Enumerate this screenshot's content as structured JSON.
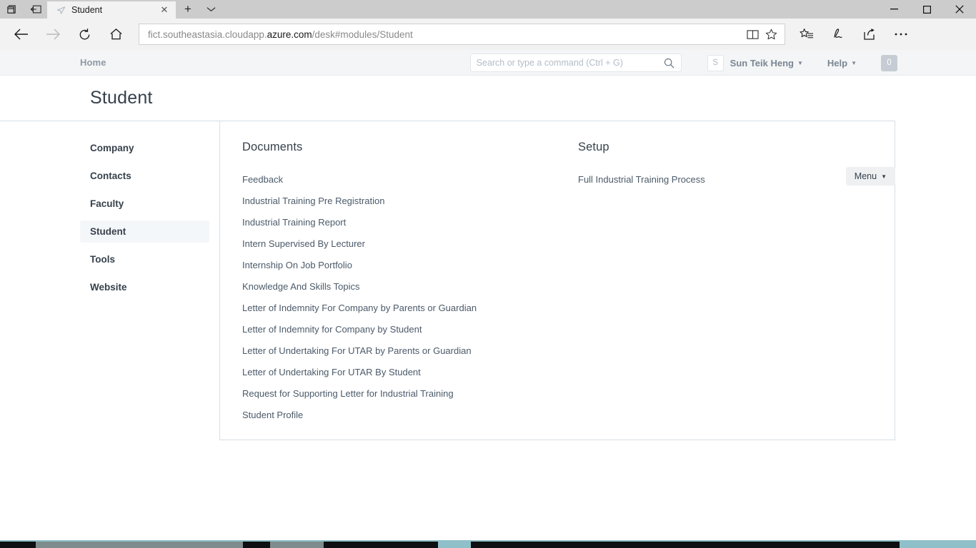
{
  "browser": {
    "titlebar_icons": [
      "tab-preview-icon",
      "set-aside-icon"
    ],
    "tab": {
      "title": "Student",
      "favicon": "paper-plane-favicon",
      "close_label": "✕"
    },
    "new_tab_label": "+",
    "tab_menu_label": "⌄",
    "window_controls": {
      "minimize": "—",
      "maximize": "□",
      "close": "✕"
    },
    "url": {
      "prefix": "fict.southeastasia.cloudapp.",
      "domain": "azure.com",
      "suffix": "/desk#modules/Student"
    },
    "toolbar_icons": [
      "back-icon",
      "forward-icon",
      "refresh-icon",
      "home-icon",
      "reading-view-icon",
      "favorite-star-icon",
      "favorites-hub-icon",
      "web-note-icon",
      "share-icon",
      "settings-more-icon"
    ]
  },
  "appnav": {
    "home_label": "Home",
    "search": {
      "placeholder": "Search or type a command (Ctrl + G)",
      "value": ""
    },
    "avatar_initial": "S",
    "user_name": "Sun Teik Heng",
    "help_label": "Help",
    "badge_count": "0"
  },
  "page": {
    "title": "Student",
    "menu_label": "Menu"
  },
  "sidebar": {
    "items": [
      {
        "label": "Company",
        "active": false
      },
      {
        "label": "Contacts",
        "active": false
      },
      {
        "label": "Faculty",
        "active": false
      },
      {
        "label": "Student",
        "active": true
      },
      {
        "label": "Tools",
        "active": false
      },
      {
        "label": "Website",
        "active": false
      }
    ]
  },
  "main": {
    "documents": {
      "heading": "Documents",
      "links": [
        "Feedback",
        "Industrial Training Pre Registration",
        "Industrial Training Report",
        "Intern Supervised By Lecturer",
        "Internship On Job Portfolio",
        "Knowledge And Skills Topics",
        "Letter of Indemnity For Company by Parents or Guardian",
        "Letter of Indemnity for Company by Student",
        "Letter of Undertaking For UTAR by Parents or Guardian",
        "Letter of Undertaking For UTAR By Student",
        "Request for Supporting Letter for Industrial Training",
        "Student Profile"
      ]
    },
    "setup": {
      "heading": "Setup",
      "links": [
        "Full Industrial Training Process"
      ]
    }
  },
  "colors": {
    "title_bar": "#cccccc",
    "browser_toolbar": "#f2f2f2",
    "app_nav": "#f4f5f6",
    "heading_text": "#36414c",
    "link_text": "#4b5a69",
    "sidebar_active_bg": "#f4f7f9",
    "card_border": "#d8dfe5",
    "badge_bg": "#c5ccd3",
    "muted_text": "#8d99a6",
    "taskbar_teal": "#8fc0c9"
  }
}
